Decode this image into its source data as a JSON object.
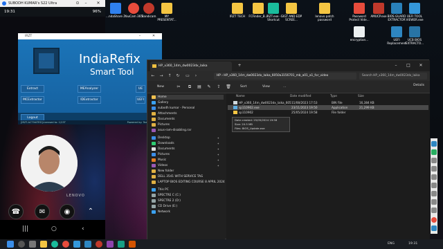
{
  "phone": {
    "window_title": "SUBODH KUMAR's S22 Ultra",
    "status_time": "19:31",
    "status_right": "96%",
    "brand_text": "LENOVO"
  },
  "desktop": {
    "icons": [
      {
        "label": "HP..."
      },
      {
        "label": "...chrome"
      },
      {
        "label": "Fi..."
      },
      {
        "label": "...ndaShare 2"
      },
      {
        "label": "YouCam 365"
      },
      {
        "label": "Bandicam"
      },
      {
        "label": "MY PRESENTAT..."
      },
      {
        "label": "IRZT TECH"
      },
      {
        "label": "FCFinder_B..."
      },
      {
        "label": "IRZT.exe - Shortcut"
      },
      {
        "label": "GIGT AND EDP SCREE..."
      },
      {
        "label": "lenovo patch password"
      },
      {
        "label": "Password Protect Vide..."
      },
      {
        "label": "AMUCP.exe"
      },
      {
        "label": "BIOS GUARD EXTRACTOR"
      },
      {
        "label": "UEFI TOOL VIEWER.exe"
      },
      {
        "label": "encryption..."
      },
      {
        "label": "UEFI Replacement"
      },
      {
        "label": "UCB BIOS EXTRACTO..."
      }
    ]
  },
  "tool": {
    "window_title": "IRZT",
    "brand_line1": "IndiaRefix",
    "brand_line2": "Smart Tool",
    "buttons": [
      "Extract",
      "MEAnalyzer",
      "UE",
      "MCExtractor",
      "IDExtractor",
      "UEFI",
      "Logout"
    ],
    "status_left": "[IRZT-ACTIVATED]Licensed to: 1/23T",
    "status_right": "Powered by: Team In..."
  },
  "explorer": {
    "tab_title": "HP_x360_14m_dw0023dx_laika",
    "address": "HP › HP_x360_14m_dw0023dx_laika_6050a3156701_mb_a01_a1_for_video",
    "search_placeholder": "Search HP_x360_14m_dw0023dx_laika",
    "toolbar": {
      "new": "New",
      "sort": "Sort",
      "view": "View",
      "more": "...",
      "details": "Details"
    },
    "sidebar": [
      {
        "label": "Home",
        "pinned": false,
        "color": "#f2c14e"
      },
      {
        "label": "Gallery",
        "pinned": false,
        "color": "#3ba1f0"
      },
      {
        "label": "subodh kumar - Personal",
        "pinned": false,
        "color": "#3b8ee8"
      },
      {
        "label": "Attachments",
        "pinned": false,
        "color": "#e0b143"
      },
      {
        "label": "Documents",
        "pinned": false,
        "color": "#e0b143"
      },
      {
        "label": "Pictures",
        "pinned": false,
        "color": "#e0b143"
      },
      {
        "label": "asus-ram-disabling.rar",
        "pinned": false,
        "color": "#9b59b6"
      },
      {
        "label": "Desktop",
        "pinned": true,
        "color": "#3b8ee8"
      },
      {
        "label": "Downloads",
        "pinned": true,
        "color": "#2ecc71"
      },
      {
        "label": "Documents",
        "pinned": true,
        "color": "#e0e0e0"
      },
      {
        "label": "Pictures",
        "pinned": true,
        "color": "#3b8ee8"
      },
      {
        "label": "Music",
        "pinned": true,
        "color": "#e67e22"
      },
      {
        "label": "Videos",
        "pinned": true,
        "color": "#9b59b6"
      },
      {
        "label": "New folder",
        "pinned": false,
        "color": "#e0b143"
      },
      {
        "label": "DELL 3541 WITH SERVICE TAG",
        "pinned": false,
        "color": "#e0b143"
      },
      {
        "label": "LAPTOP BIOS EDITING COURSE 8 APRIL 2024",
        "pinned": false,
        "color": "#e0b143"
      },
      {
        "label": "This PC",
        "pinned": false,
        "color": "#3ba1f0"
      },
      {
        "label": "SPECTRE C (C:)",
        "pinned": false,
        "color": "#95a5a6"
      },
      {
        "label": "SPECTRE 2 (D:)",
        "pinned": false,
        "color": "#95a5a6"
      },
      {
        "label": "CD Drive (E:)",
        "pinned": false,
        "color": "#95a5a6"
      },
      {
        "label": "Network",
        "pinned": false,
        "color": "#3ba1f0"
      }
    ],
    "columns": [
      "Name",
      "Date modified",
      "Type",
      "Size"
    ],
    "rows": [
      {
        "name": "HP_x360_14m_dw0023dx_laika_6050a3...",
        "date": "11/08/2023 17:53",
        "type": "BIN File",
        "size": "16,384 KB",
        "color": "#cfd8dc",
        "selected": false
      },
      {
        "name": "sp110902.exe",
        "date": "23/11/2023 19:50",
        "type": "Application",
        "size": "21,299 KB",
        "color": "#5dade2",
        "selected": true
      },
      {
        "name": "sp110902",
        "date": "25/05/2024 19:58",
        "type": "File folder",
        "size": "",
        "color": "#f4c542",
        "selected": false
      }
    ],
    "tooltip": [
      "Date created: 25/05/2024 19:58",
      "Size: 20.5 MB",
      "Files: BIOS_Update.exe"
    ]
  },
  "taskbar": {
    "tray_left": "ENG",
    "tray_time": "19:31"
  }
}
